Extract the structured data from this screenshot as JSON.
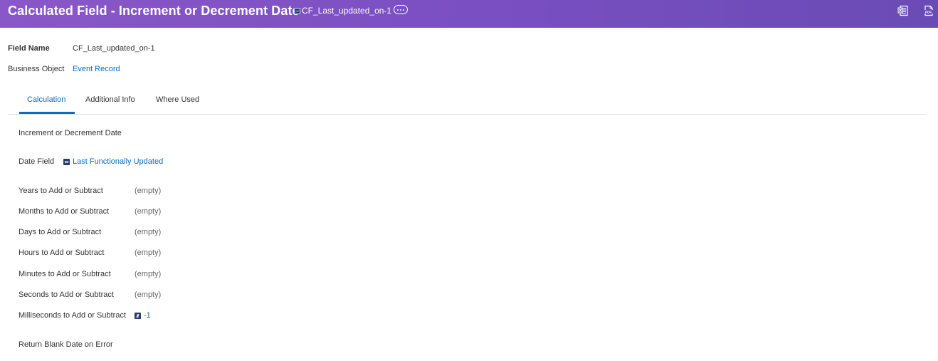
{
  "header": {
    "title": "Calculated Field - Increment or Decrement Date",
    "instance_name": "CF_Last_updated_on-1",
    "icons": [
      "related-actions-icon",
      "excel-export-icon",
      "pdf-export-icon"
    ]
  },
  "summary": {
    "field_name_label": "Field Name",
    "field_name_value": "CF_Last_updated_on-1",
    "business_object_label": "Business Object",
    "business_object_value": "Event Record"
  },
  "tabs": [
    {
      "label": "Calculation",
      "active": true
    },
    {
      "label": "Additional Info",
      "active": false
    },
    {
      "label": "Where Used",
      "active": false
    }
  ],
  "calculation": {
    "function_name": "Increment or Decrement Date",
    "date_field_label": "Date Field",
    "date_field_value": "Last Functionally Updated",
    "rows": [
      {
        "label": "Years to Add or Subtract",
        "value": "(empty)"
      },
      {
        "label": "Months to Add or Subtract",
        "value": "(empty)"
      },
      {
        "label": "Days to Add or Subtract",
        "value": "(empty)"
      },
      {
        "label": "Hours to Add or Subtract",
        "value": "(empty)"
      },
      {
        "label": "Minutes to Add or Subtract",
        "value": "(empty)"
      },
      {
        "label": "Seconds to Add or Subtract",
        "value": "(empty)"
      }
    ],
    "milliseconds_label": "Milliseconds to Add or Subtract",
    "milliseconds_value": "-1",
    "return_blank_label": "Return Blank Date on Error"
  },
  "colors": {
    "header_start": "#8a57c8",
    "header_end": "#6a4bb5",
    "link": "#0c6abf",
    "tab_active": "#0c6abf"
  }
}
